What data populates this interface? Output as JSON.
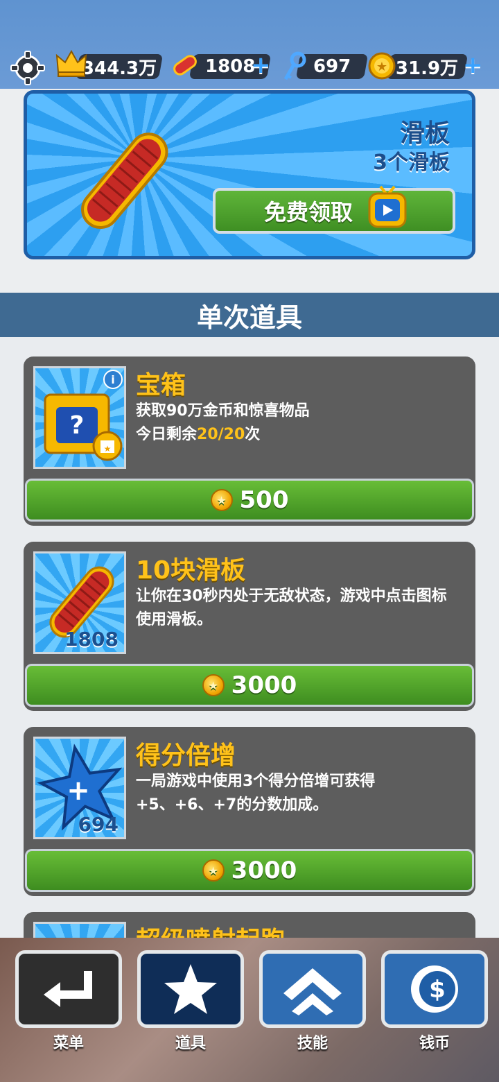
{
  "topbar": {
    "score": "344.3万",
    "hoverboards": "1808",
    "keys": "697",
    "coins": "31.9万",
    "icons": [
      "gear-icon",
      "crown-icon",
      "hoverboard-icon",
      "key-icon",
      "coin-icon",
      "plus-icon"
    ]
  },
  "hero": {
    "title": "滑板",
    "subtitle": "3个滑板",
    "button_label": "免费领取"
  },
  "section": {
    "title": "单次道具"
  },
  "items": [
    {
      "title": "宝箱",
      "desc_line1": "获取90万金币和惊喜物品",
      "desc_prefix": "今日剩余",
      "desc_highlight": "20/20",
      "desc_suffix": "次",
      "price": "500"
    },
    {
      "title": "10块滑板",
      "desc": "让你在30秒内处于无敌状态，游戏中点击图标使用滑板。",
      "count": "1808",
      "price": "3000"
    },
    {
      "title": "得分倍增",
      "desc": "一局游戏中使用3个得分倍增可获得+5、+6、+7的分数加成。",
      "count": "694",
      "price": "3000"
    },
    {
      "title": "超级喷射起跑"
    }
  ],
  "nav": {
    "menu": "菜单",
    "items": "道具",
    "skills": "技能",
    "coins": "钱币"
  },
  "colors": {
    "topbar": "#6b9bd6",
    "section_header": "#3f6a92",
    "card": "#5d5d5d",
    "title_gold": "#ffc21a",
    "button_green": "#4fa12b"
  }
}
